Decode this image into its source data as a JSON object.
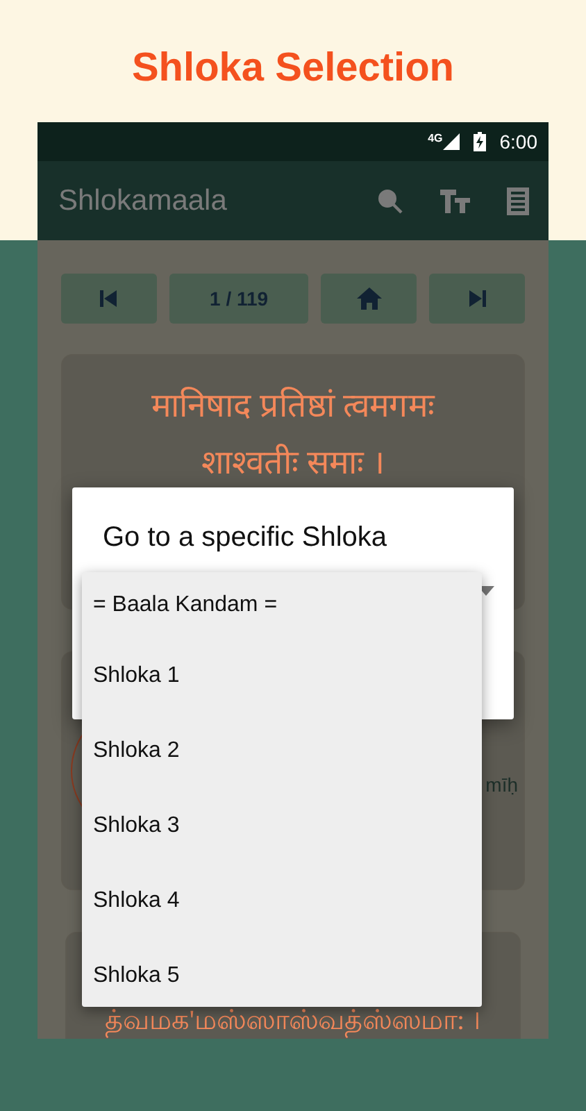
{
  "page_title": "Shloka Selection",
  "status_bar": {
    "network": "4G",
    "time": "6:00"
  },
  "app_bar": {
    "title": "Shlokamaala"
  },
  "nav": {
    "counter": "1 / 119"
  },
  "cards": [
    {
      "lines": [
        "मानिषाद प्रतिष्ठां त्वमगमः",
        "शाश्वतीः समाः ।"
      ]
    },
    {
      "fragment": "mīḥ"
    },
    {
      "lines": [
        "த்வமக'மஸ்ஸாஸ்வத்ஸ்ஸமா: ।"
      ]
    }
  ],
  "dialog": {
    "title": "Go to a specific Shloka",
    "options": [
      {
        "label": "= Baala Kandam ="
      },
      {
        "label": "Shloka 1"
      },
      {
        "label": "Shloka 2"
      },
      {
        "label": "Shloka 3"
      },
      {
        "label": "Shloka 4"
      },
      {
        "label": "Shloka 5"
      }
    ]
  }
}
